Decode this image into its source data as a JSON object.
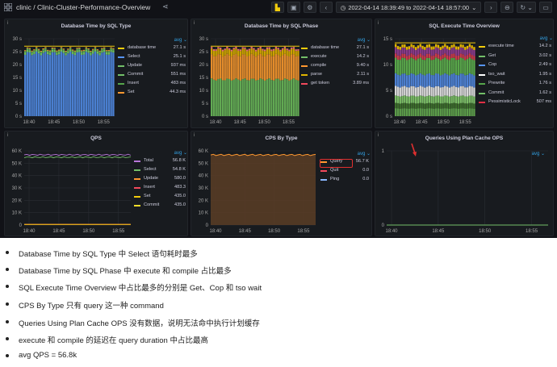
{
  "topbar": {
    "title": "clinic / Clinic-Cluster-Performance-Overview",
    "time_range": "2022-04-14 18:39:49 to 2022-04-14 18:57:00"
  },
  "panels": [
    {
      "title": "Database Time by SQL Type",
      "legend_mode": "avg",
      "legend": [
        {
          "name": "database time",
          "value": "27.1 s",
          "color": "#f2cc0c"
        },
        {
          "name": "Select",
          "value": "25.1 s",
          "color": "#5794f2"
        },
        {
          "name": "Update",
          "value": "937 ms",
          "color": "#73bf69"
        },
        {
          "name": "Commit",
          "value": "551 ms",
          "color": "#73bf69"
        },
        {
          "name": "Insert",
          "value": "483 ms",
          "color": "#56a64b"
        },
        {
          "name": "Set",
          "value": "44.3 ms",
          "color": "#ff9830"
        }
      ]
    },
    {
      "title": "Database Time by SQL Phase",
      "legend_mode": "avg",
      "legend": [
        {
          "name": "database time",
          "value": "27.1 s",
          "color": "#f2cc0c"
        },
        {
          "name": "execute",
          "value": "14.2 s",
          "color": "#73bf69"
        },
        {
          "name": "compile",
          "value": "9.40 s",
          "color": "#ff9830"
        },
        {
          "name": "parse",
          "value": "2.11 s",
          "color": "#e0b400"
        },
        {
          "name": "get token",
          "value": "3.89 ms",
          "color": "#f2495c"
        }
      ]
    },
    {
      "title": "SQL Execute Time Overview",
      "legend_mode": "avg",
      "legend": [
        {
          "name": "execute time",
          "value": "14.2 s",
          "color": "#f2cc0c"
        },
        {
          "name": "Get",
          "value": "3.02 s",
          "color": "#73bf69"
        },
        {
          "name": "Cop",
          "value": "2.49 s",
          "color": "#5794f2"
        },
        {
          "name": "tso_wait",
          "value": "1.95 s",
          "color": "#ffffff"
        },
        {
          "name": "Prewrite",
          "value": "1.76 s",
          "color": "#56a64b"
        },
        {
          "name": "Commit",
          "value": "1.62 s",
          "color": "#73bf69"
        },
        {
          "name": "PessimisticLock",
          "value": "507 ms",
          "color": "#e02f44"
        }
      ]
    },
    {
      "title": "QPS",
      "legend_mode": "avg",
      "legend": [
        {
          "name": "Total",
          "value": "56.8 K",
          "color": "#b877d9"
        },
        {
          "name": "Select",
          "value": "54.8 K",
          "color": "#73bf69"
        },
        {
          "name": "Update",
          "value": "580.0",
          "color": "#ff9830"
        },
        {
          "name": "Insert",
          "value": "483.3",
          "color": "#f2495c"
        },
        {
          "name": "Set",
          "value": "435.0",
          "color": "#f2cc0c"
        },
        {
          "name": "Commit",
          "value": "435.0",
          "color": "#fade2a"
        }
      ]
    },
    {
      "title": "CPS By Type",
      "legend_mode": "avg",
      "legend": [
        {
          "name": "Query",
          "value": "56.7 K",
          "color": "#ff9830"
        },
        {
          "name": "Quit",
          "value": "0.0",
          "color": "#f2495c"
        },
        {
          "name": "Ping",
          "value": "0.0",
          "color": "#8ab8ff"
        }
      ]
    },
    {
      "title": "Queries Using Plan Cache OPS",
      "legend_mode": "avg",
      "legend": []
    }
  ],
  "charts": [
    {
      "yticks": [
        "30 s",
        "25 s",
        "20 s",
        "15 s",
        "10 s",
        "5 s",
        "0 s"
      ],
      "xticks": [
        "18:40",
        "18:45",
        "18:50",
        "18:55"
      ]
    },
    {
      "yticks": [
        "30 s",
        "25 s",
        "20 s",
        "15 s",
        "10 s",
        "5 s",
        "0 s"
      ],
      "xticks": [
        "18:40",
        "18:45",
        "18:50",
        "18:55"
      ]
    },
    {
      "yticks": [
        "15 s",
        "10 s",
        "5 s",
        "0 s"
      ],
      "xticks": [
        "18:40",
        "18:45",
        "18:50",
        "18:55"
      ]
    },
    {
      "yticks": [
        "60 K",
        "50 K",
        "40 K",
        "30 K",
        "20 K",
        "10 K",
        "0"
      ],
      "xticks": [
        "18:40",
        "18:45",
        "18:50",
        "18:55"
      ]
    },
    {
      "yticks": [
        "60 K",
        "50 K",
        "40 K",
        "30 K",
        "20 K",
        "10 K",
        "0"
      ],
      "xticks": [
        "18:40",
        "18:45",
        "18:50",
        "18:55"
      ]
    },
    {
      "yticks": [
        "1",
        "0"
      ],
      "xticks": [
        "18:40",
        "18:45",
        "18:50",
        "18:55"
      ]
    }
  ],
  "chart_data": [
    {
      "type": "area",
      "title": "Database Time by SQL Type",
      "x": [
        "18:40",
        "18:45",
        "18:50",
        "18:55"
      ],
      "ylim": [
        0,
        30
      ],
      "series": [
        {
          "name": "Select",
          "values": [
            25.1,
            25.1,
            25.1,
            25.1
          ]
        },
        {
          "name": "database time",
          "values": [
            27.1,
            27.1,
            27.1,
            27.1
          ]
        }
      ]
    },
    {
      "type": "area",
      "title": "Database Time by SQL Phase",
      "x": [
        "18:40",
        "18:45",
        "18:50",
        "18:55"
      ],
      "ylim": [
        0,
        30
      ],
      "series": [
        {
          "name": "execute",
          "values": [
            14.2,
            14.2,
            14.2,
            14.2
          ]
        },
        {
          "name": "compile",
          "values": [
            9.4,
            9.4,
            9.4,
            9.4
          ]
        },
        {
          "name": "parse",
          "values": [
            2.11,
            2.11,
            2.11,
            2.11
          ]
        }
      ]
    },
    {
      "type": "area",
      "title": "SQL Execute Time Overview",
      "x": [
        "18:40",
        "18:45",
        "18:50",
        "18:55"
      ],
      "ylim": [
        0,
        15
      ],
      "series": [
        {
          "name": "execute time",
          "values": [
            14.2,
            14.2,
            14.2,
            14.2
          ]
        }
      ]
    },
    {
      "type": "line",
      "title": "QPS",
      "x": [
        "18:40",
        "18:45",
        "18:50",
        "18:55"
      ],
      "ylim": [
        0,
        60000
      ],
      "series": [
        {
          "name": "Total",
          "values": [
            56800,
            56800,
            56800,
            56800
          ]
        },
        {
          "name": "Select",
          "values": [
            54800,
            54800,
            54800,
            54800
          ]
        }
      ]
    },
    {
      "type": "area",
      "title": "CPS By Type",
      "x": [
        "18:40",
        "18:45",
        "18:50",
        "18:55"
      ],
      "ylim": [
        0,
        60000
      ],
      "series": [
        {
          "name": "Query",
          "values": [
            56700,
            56700,
            56700,
            56700
          ]
        }
      ]
    },
    {
      "type": "line",
      "title": "Queries Using Plan Cache OPS",
      "x": [
        "18:40",
        "18:45",
        "18:50",
        "18:55"
      ],
      "ylim": [
        0,
        1
      ],
      "series": [
        {
          "values": [
            0,
            0,
            0,
            0
          ]
        }
      ]
    }
  ],
  "notes": [
    "Database Time by SQL Type 中 Select 语句耗时最多",
    "Database Time by SQL Phase 中 execute 和 compile 占比最多",
    "SQL Execute Time Overview 中占比最多的分别是 Get、Cop 和 tso wait",
    "CPS By Type 只有 query 这一种 command",
    "Queries Using Plan Cache OPS 没有数据，说明无法命中执行计划缓存",
    "execute 和 compile 的延迟在 query duration 中占比最高",
    "avg QPS = 56.8k"
  ]
}
